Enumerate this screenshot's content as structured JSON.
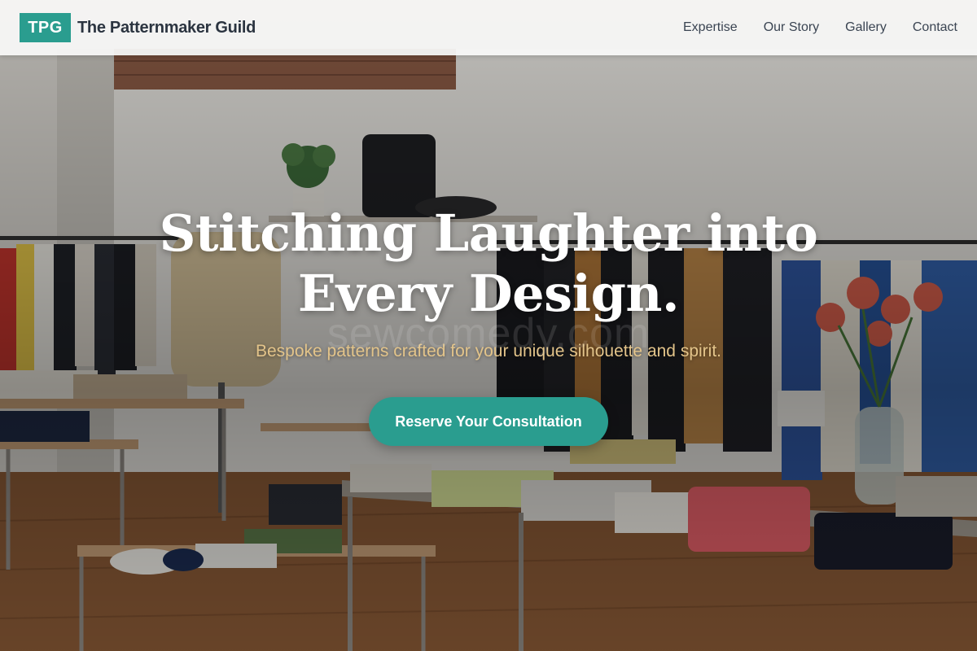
{
  "brand": {
    "mark": "TPG",
    "name": "The Patternmaker Guild"
  },
  "nav": {
    "items": [
      {
        "label": "Expertise"
      },
      {
        "label": "Our Story"
      },
      {
        "label": "Gallery"
      },
      {
        "label": "Contact"
      }
    ]
  },
  "hero": {
    "headline_line1": "Stitching Laughter into",
    "headline_line2": "Every Design.",
    "watermark": "sewcomedy.com",
    "subhead": "Bespoke patterns crafted for your unique silhouette and spirit.",
    "cta_label": "Reserve Your Consultation"
  },
  "colors": {
    "accent": "#2a9d8f",
    "subhead": "#e3c48a",
    "header_bg": "#f8f8f6",
    "nav_text": "#3a4452"
  }
}
